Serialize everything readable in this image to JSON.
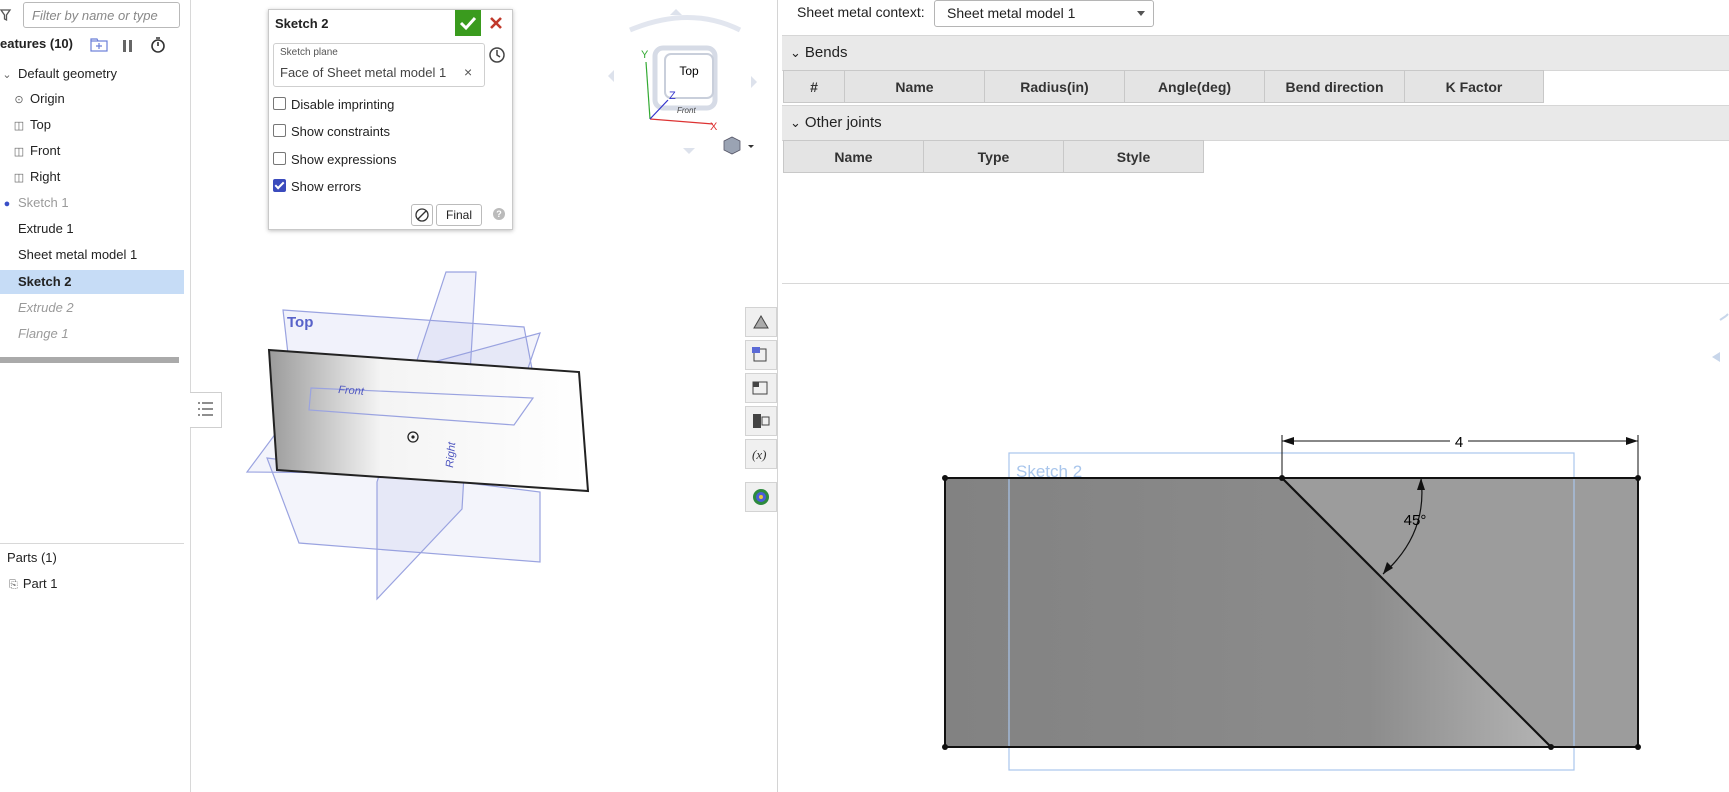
{
  "features": {
    "filter_placeholder": "Filter by name or type",
    "header": "eatures (10)",
    "items": [
      {
        "label": "Default geometry",
        "icon": "chevron-icon"
      },
      {
        "label": "Origin",
        "icon": "origin-icon"
      },
      {
        "label": "Top",
        "icon": "plane-icon"
      },
      {
        "label": "Front",
        "icon": "plane-icon"
      },
      {
        "label": "Right",
        "icon": "plane-icon"
      },
      {
        "label": "Sketch 1",
        "icon": "sketch-icon"
      },
      {
        "label": "Extrude 1",
        "icon": "extrude-icon"
      },
      {
        "label": "Sheet metal model 1",
        "icon": "sheet-metal-icon"
      },
      {
        "label": "Sketch 2",
        "icon": "sketch-icon"
      },
      {
        "label": "Extrude 2",
        "icon": "extrude-icon"
      },
      {
        "label": "Flange 1",
        "icon": "flange-icon"
      }
    ],
    "parts_header": "Parts (1)",
    "part_item": "Part 1"
  },
  "dialog": {
    "title": "Sketch 2",
    "sketch_plane_label": "Sketch plane",
    "sketch_plane_value": "Face of Sheet metal model 1",
    "checkboxes": [
      {
        "label": "Disable imprinting",
        "checked": false
      },
      {
        "label": "Show constraints",
        "checked": false
      },
      {
        "label": "Show expressions",
        "checked": false
      },
      {
        "label": "Show errors",
        "checked": true
      }
    ],
    "final_label": "Final",
    "accept_color": "#3a9b1e",
    "cancel_color": "#c0392b"
  },
  "viewport": {
    "view_cube_label": "Top",
    "axis_y": "Y",
    "axis_z": "Z",
    "axis_x": "X",
    "cube_front": "Front",
    "plane_top": "Top",
    "plane_front": "Front",
    "plane_right": "Right"
  },
  "sheet_metal": {
    "context_label": "Sheet metal context:",
    "context_value": "Sheet metal model 1",
    "bends_title": "Bends",
    "bends_columns": [
      "#",
      "Name",
      "Radius(in)",
      "Angle(deg)",
      "Bend direction",
      "K Factor"
    ],
    "joints_title": "Other joints",
    "joints_columns": [
      "Name",
      "Type",
      "Style"
    ]
  },
  "flat_view": {
    "sketch_label": "Sketch 2",
    "dimension": "4",
    "angle": "45°"
  }
}
